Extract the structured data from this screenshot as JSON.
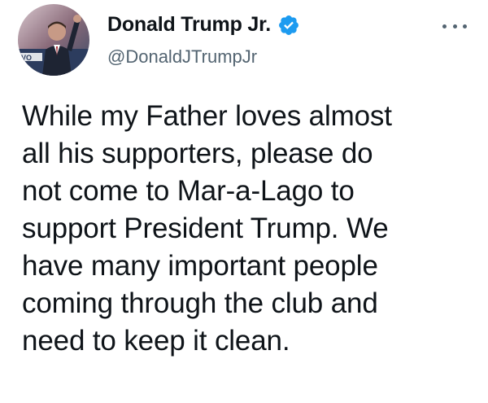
{
  "author": {
    "display_name": "Donald Trump Jr.",
    "handle": "@DonaldJTrumpJr",
    "verified": true,
    "avatar_icon": "profile-photo",
    "verified_icon": "verified-badge-icon"
  },
  "menu": {
    "icon": "more-options-icon"
  },
  "tweet": {
    "text": "While my Father loves almost\nall his supporters, please do\nnot come to Mar-a-Lago to\nsupport President Trump. We\nhave many important people\ncoming through the club and\nneed to keep it clean."
  },
  "colors": {
    "text_primary": "#0f1419",
    "text_secondary": "#536471",
    "verified_blue": "#1d9bf0",
    "background": "#ffffff"
  }
}
